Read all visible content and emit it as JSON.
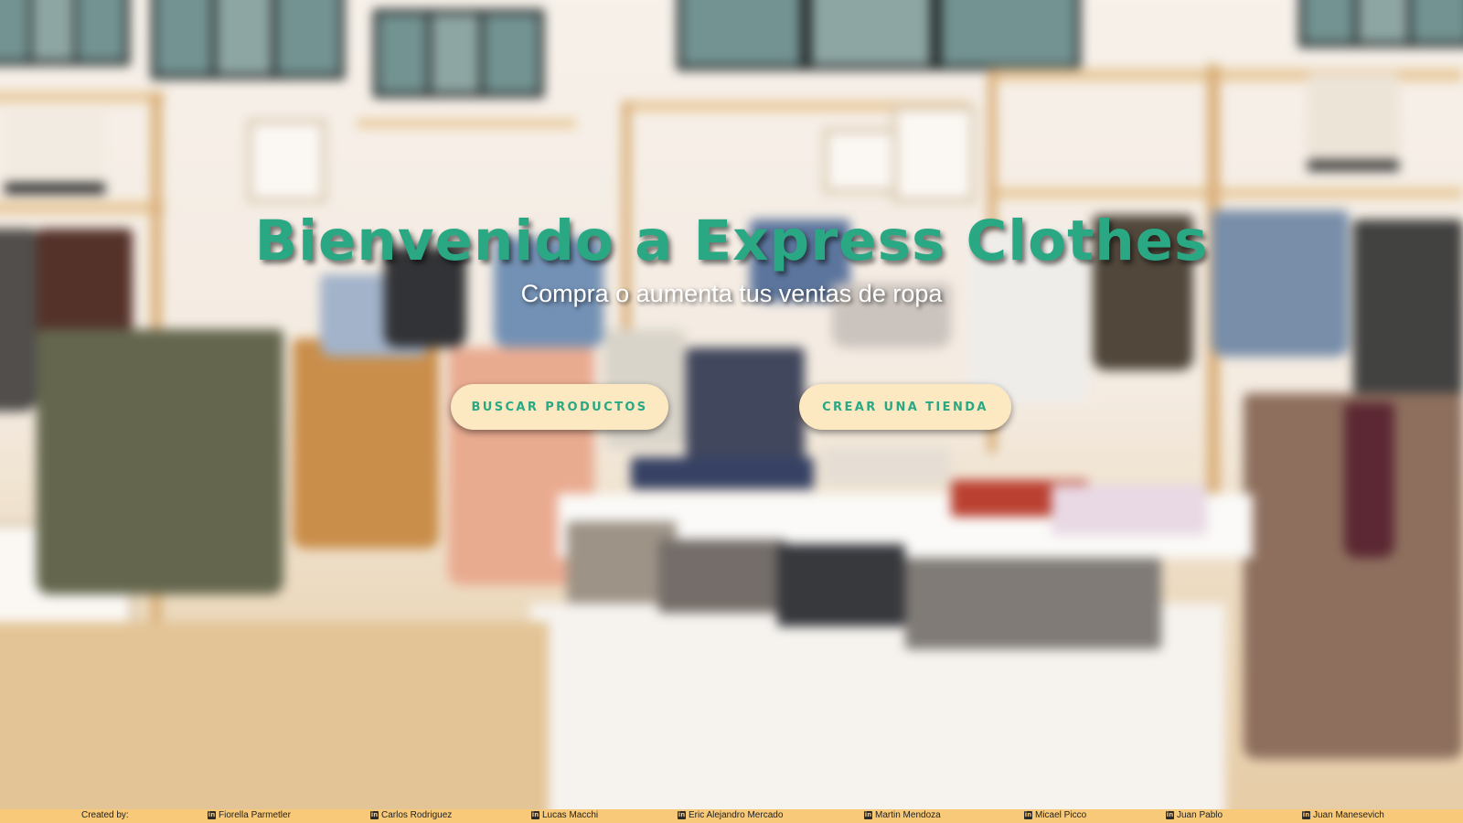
{
  "hero": {
    "title": "Bienvenido a Express Clothes",
    "subtitle": "Compra o aumenta tus ventas de ropa",
    "buttons": {
      "search_products": "BUSCAR PRODUCTOS",
      "create_store": "CREAR UNA TIENDA"
    }
  },
  "footer": {
    "created_by_label": "Created by:",
    "authors": [
      {
        "name": "Fiorella Parmetler",
        "icon": "linkedin-icon"
      },
      {
        "name": "Carlos Rodriguez",
        "icon": "linkedin-icon"
      },
      {
        "name": "Lucas Macchi",
        "icon": "linkedin-icon"
      },
      {
        "name": "Eric Alejandro Mercado",
        "icon": "linkedin-icon"
      },
      {
        "name": "Martin Mendoza",
        "icon": "linkedin-icon"
      },
      {
        "name": "Micael Picco",
        "icon": "linkedin-icon"
      },
      {
        "name": "Juan Pablo",
        "icon": "linkedin-icon"
      },
      {
        "name": "Juan Manesevich",
        "icon": "linkedin-icon"
      }
    ]
  },
  "colors": {
    "brand_green": "#2aa883",
    "button_bg": "#fde9c1",
    "footer_bg": "#f8c978"
  }
}
